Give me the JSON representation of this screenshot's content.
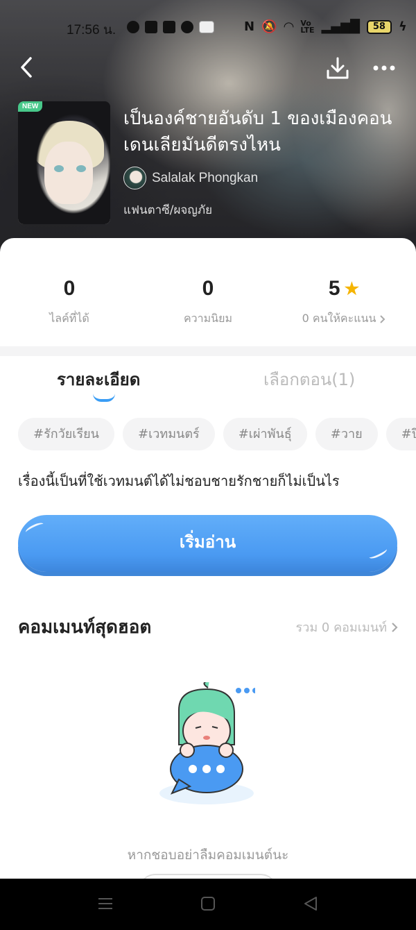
{
  "status_bar": {
    "time": "17:56 น.",
    "battery": "58"
  },
  "header": {
    "badge": "NEW",
    "title": "เป็นองค์ชายอันดับ 1 ของเมืองคอนเดนเลียมันดีตรงไหน",
    "author": "Salalak Phongkan",
    "genre": "แฟนตาซี/ผจญภัย"
  },
  "stats": {
    "likes": {
      "value": "0",
      "label": "ไลค์ที่ได้"
    },
    "popularity": {
      "value": "0",
      "label": "ความนิยม"
    },
    "rating": {
      "value": "5",
      "label": "0 คนให้คะแนน"
    }
  },
  "tabs": [
    {
      "label": "รายละเอียด",
      "active": true
    },
    {
      "label": "เลือกตอน(1)",
      "active": false
    }
  ],
  "tags": [
    "#รักวัยเรียน",
    "#เวทมนตร์",
    "#เผ่าพันธุ์",
    "#วาย",
    "#ปีศ"
  ],
  "description": "เรื่องนี้เป็นที่ใช้เวทมนต์ได้ไม่ชอบชายรักชายก็ไม่เป็นไร",
  "read_button": "เริ่มอ่าน",
  "comments": {
    "heading": "คอมเมนท์สุดฮอต",
    "total": "รวม 0 คอมเมนท์",
    "empty_text": "หากชอบอย่าลืมคอมเมนต์นะ"
  },
  "colors": {
    "accent": "#4a9af2",
    "star": "#f5b400",
    "new_badge": "#48c88a"
  }
}
